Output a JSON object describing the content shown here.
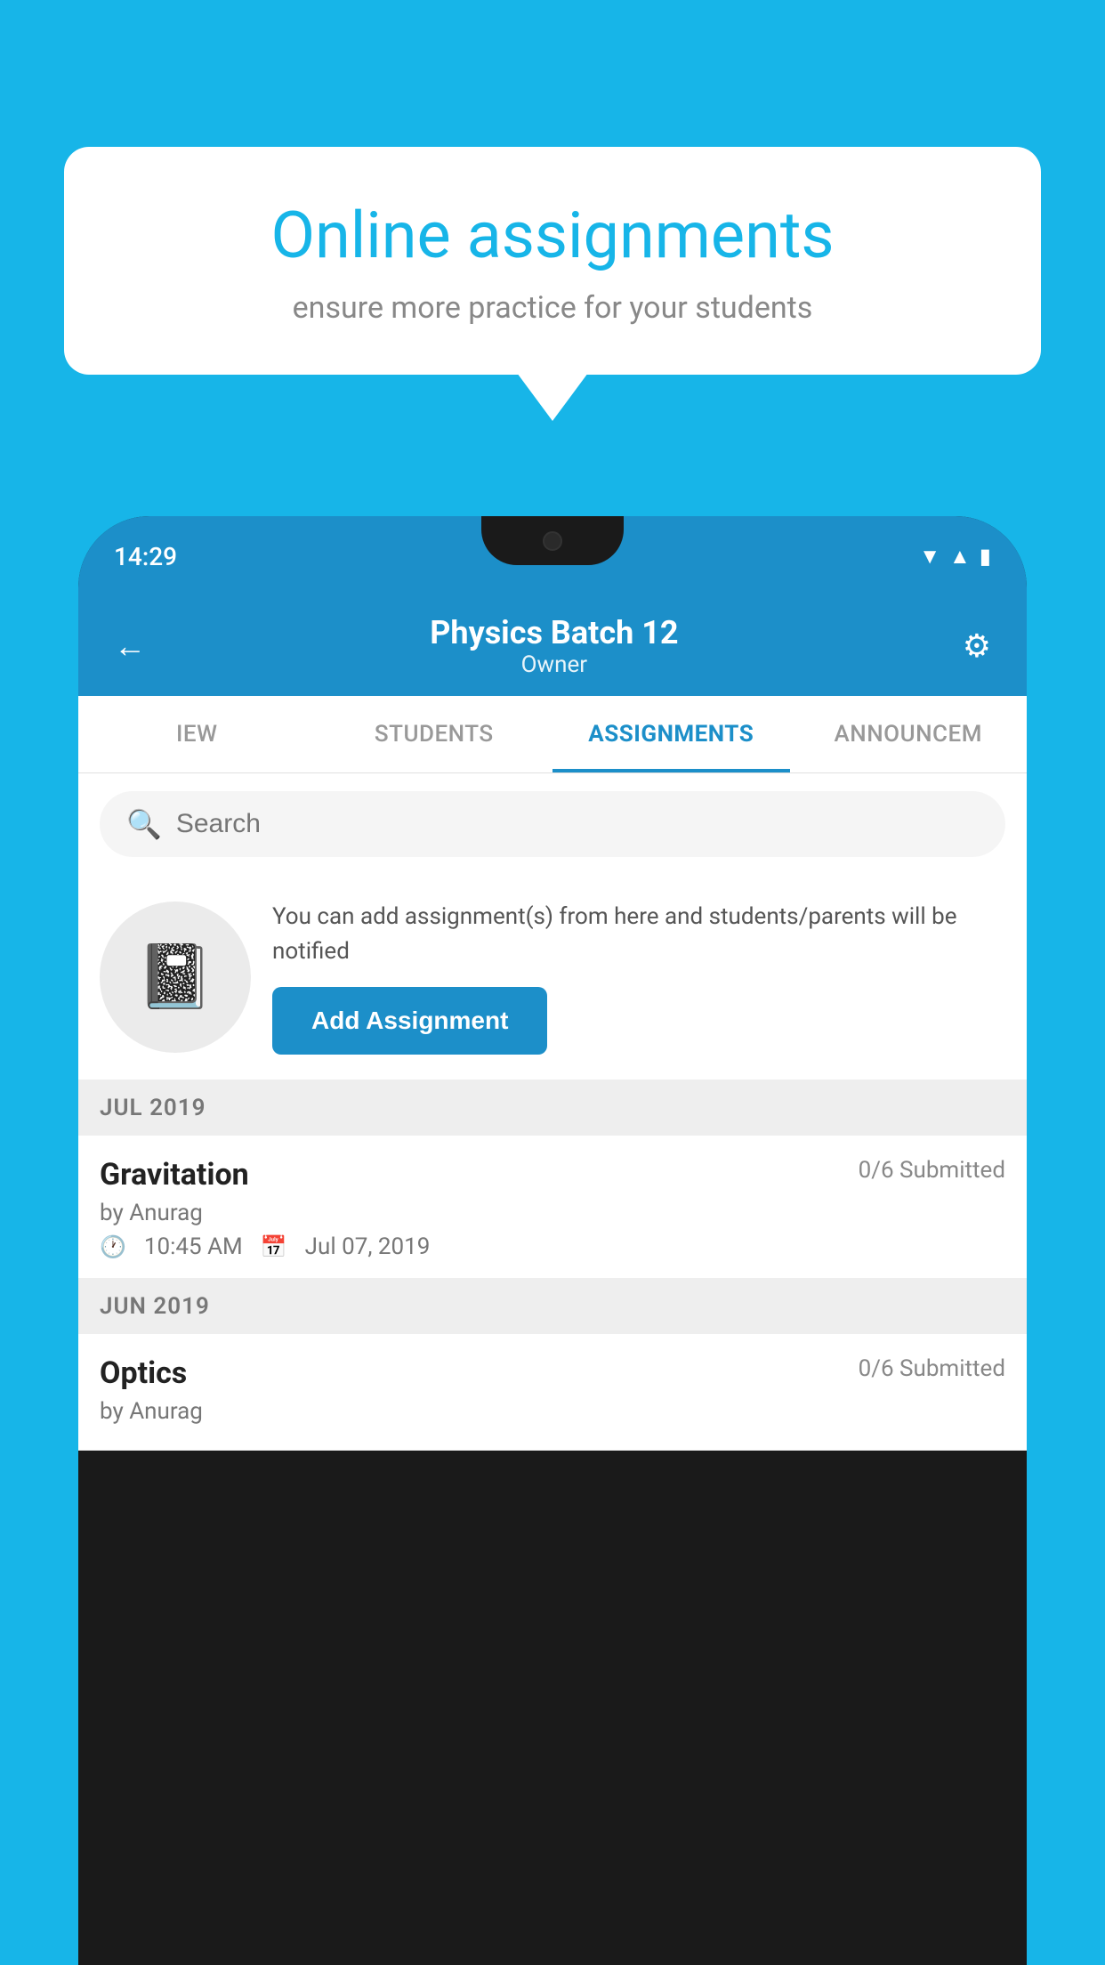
{
  "background": {
    "color": "#17b5e8"
  },
  "speech_bubble": {
    "title": "Online assignments",
    "subtitle": "ensure more practice for your students"
  },
  "phone": {
    "status_bar": {
      "time": "14:29"
    },
    "header": {
      "title": "Physics Batch 12",
      "subtitle": "Owner"
    },
    "tabs": [
      {
        "label": "IEW",
        "active": false
      },
      {
        "label": "STUDENTS",
        "active": false
      },
      {
        "label": "ASSIGNMENTS",
        "active": true
      },
      {
        "label": "ANNOUNCEM",
        "active": false
      }
    ],
    "search": {
      "placeholder": "Search"
    },
    "add_assignment": {
      "description": "You can add assignment(s) from here and students/parents will be notified",
      "button_label": "Add Assignment"
    },
    "sections": [
      {
        "label": "JUL 2019",
        "items": [
          {
            "name": "Gravitation",
            "submitted": "0/6 Submitted",
            "by": "by Anurag",
            "time": "10:45 AM",
            "date": "Jul 07, 2019"
          }
        ]
      },
      {
        "label": "JUN 2019",
        "items": [
          {
            "name": "Optics",
            "submitted": "0/6 Submitted",
            "by": "by Anurag",
            "time": "",
            "date": ""
          }
        ]
      }
    ]
  }
}
